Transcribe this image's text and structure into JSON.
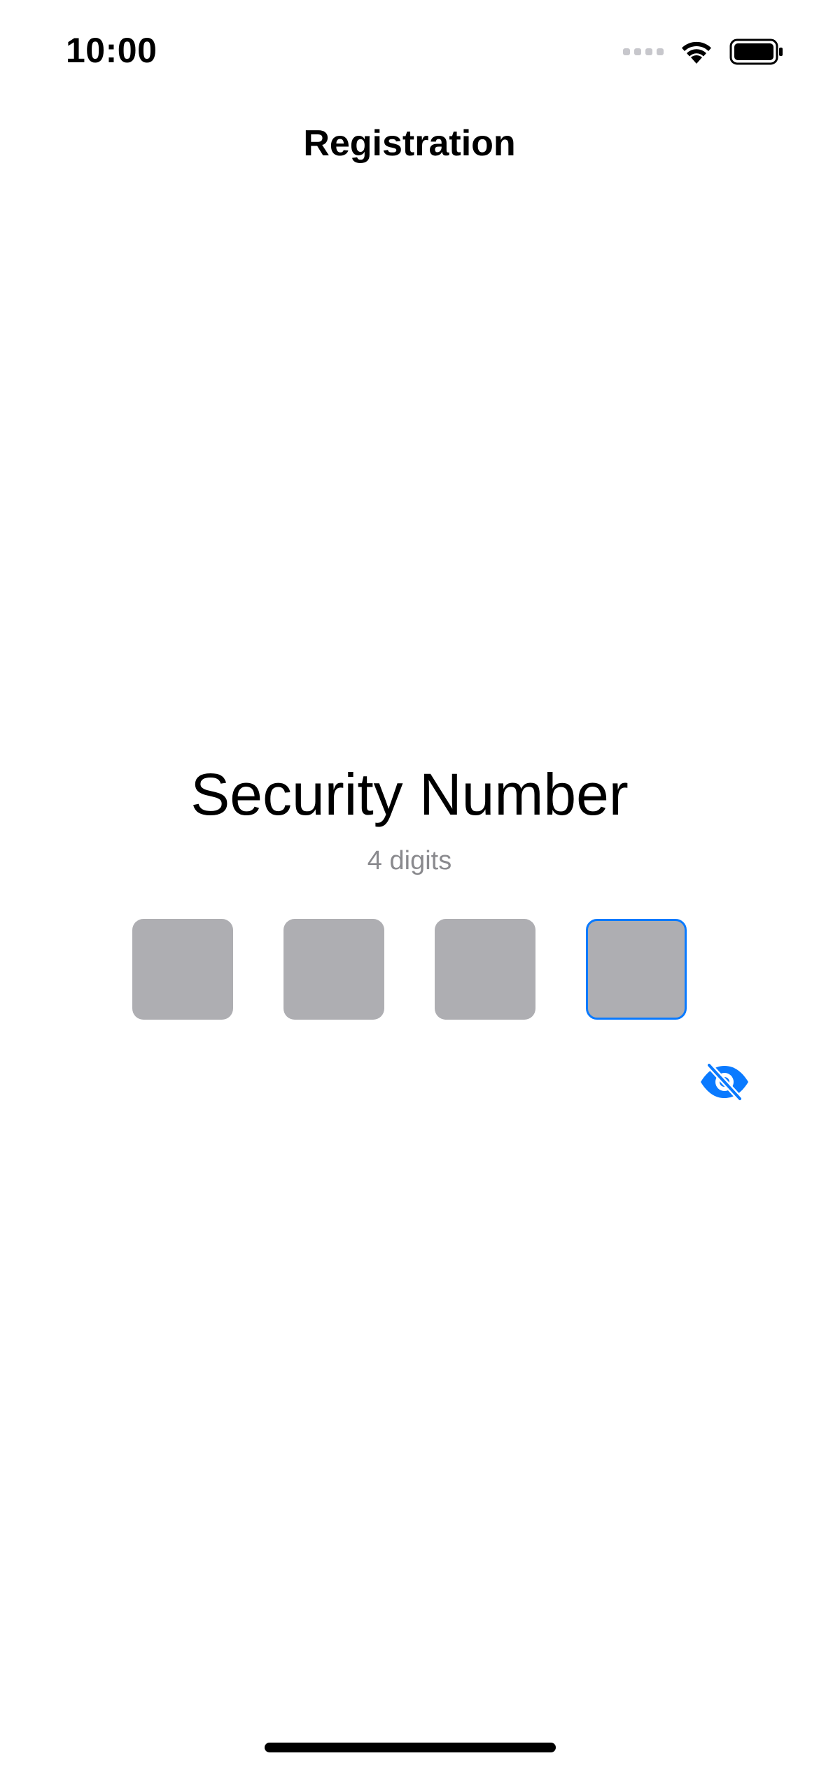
{
  "status_bar": {
    "time": "10:00",
    "icons": [
      "cellular-signal-icon",
      "wifi-icon",
      "battery-icon"
    ]
  },
  "nav": {
    "title": "Registration"
  },
  "security": {
    "title": "Security Number",
    "subtitle": "4 digits",
    "digit_count": 4,
    "active_box_index": 3,
    "entered_values": [
      "",
      "",
      "",
      ""
    ]
  },
  "visibility_toggle": {
    "icon": "eye-slash-icon",
    "state": "hidden"
  },
  "colors": {
    "accent": "#0a7aff",
    "box_fill": "#aeaeb2",
    "subtitle": "#8a8a8e",
    "background": "#ffffff"
  }
}
